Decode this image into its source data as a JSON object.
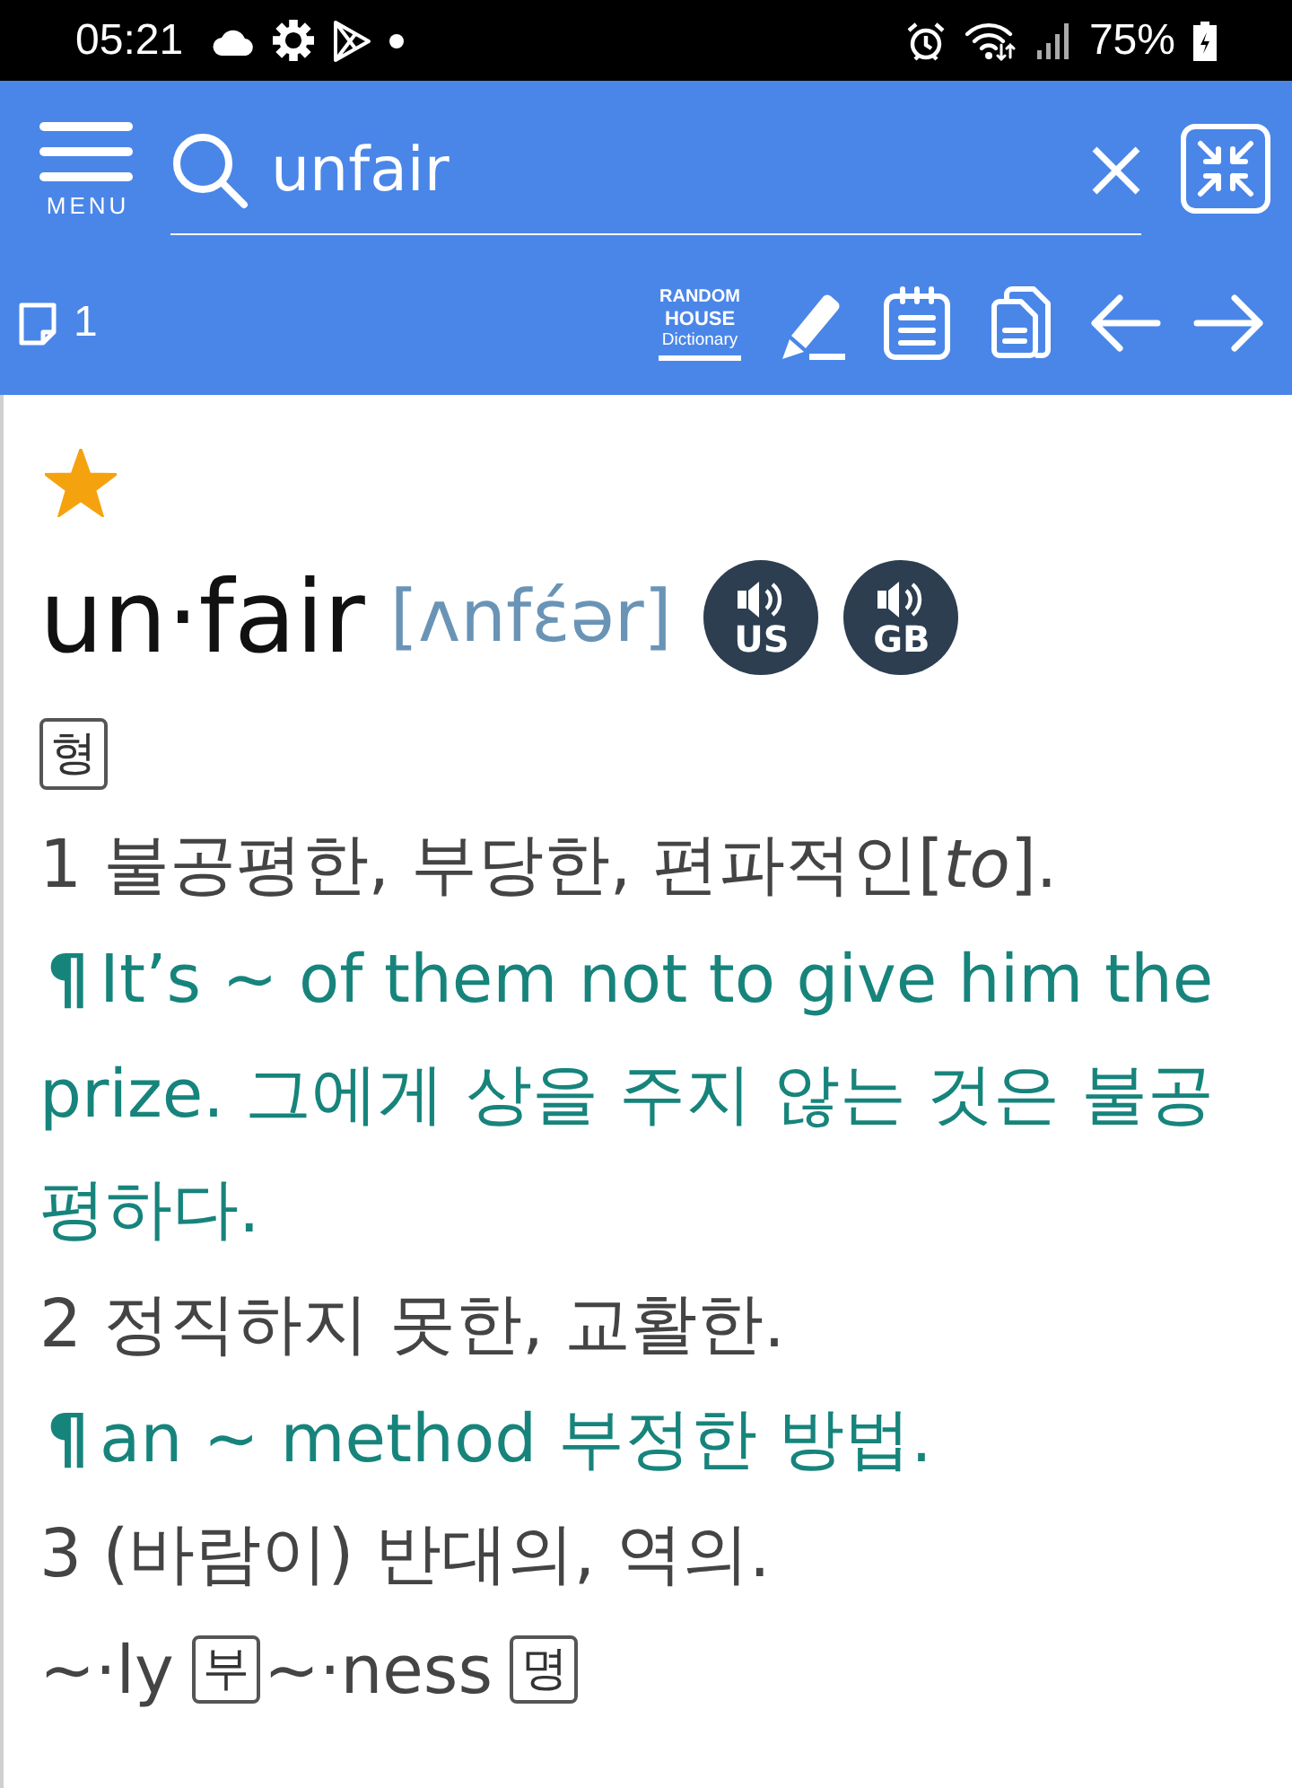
{
  "status_bar": {
    "time": "05:21",
    "battery": "75%"
  },
  "header": {
    "menu_label": "MENU",
    "search": {
      "value": "unfair"
    },
    "note_count": "1",
    "dictionary_logo": [
      "RANDOM",
      "HOUSE",
      "Dictionary"
    ]
  },
  "entry": {
    "starred": true,
    "headword": "un·fair",
    "pronunciation": "[ʌnfɛ́ər]",
    "audio": [
      {
        "label": "US"
      },
      {
        "label": "GB"
      }
    ],
    "part_of_speech": "형",
    "senses": [
      {
        "kind": "definition",
        "text": "1 불공평한, 부당한, 편파적인[*to*]."
      },
      {
        "kind": "example",
        "marker": "¶",
        "text": "It’s ~ of them not to give him the prize. 그에게 상을 주지 않는 것은 불공평하다."
      },
      {
        "kind": "definition",
        "text": "2 정직하지 못한, 교활한."
      },
      {
        "kind": "example",
        "marker": "¶",
        "text": "an ~ method 부정한 방법."
      },
      {
        "kind": "definition",
        "text": "3 (바람이) 반대의, 역의."
      }
    ],
    "derivatives": [
      {
        "form": "~·ly",
        "part_of_speech": "부"
      },
      {
        "form": "~·ness",
        "part_of_speech": "명"
      }
    ]
  }
}
